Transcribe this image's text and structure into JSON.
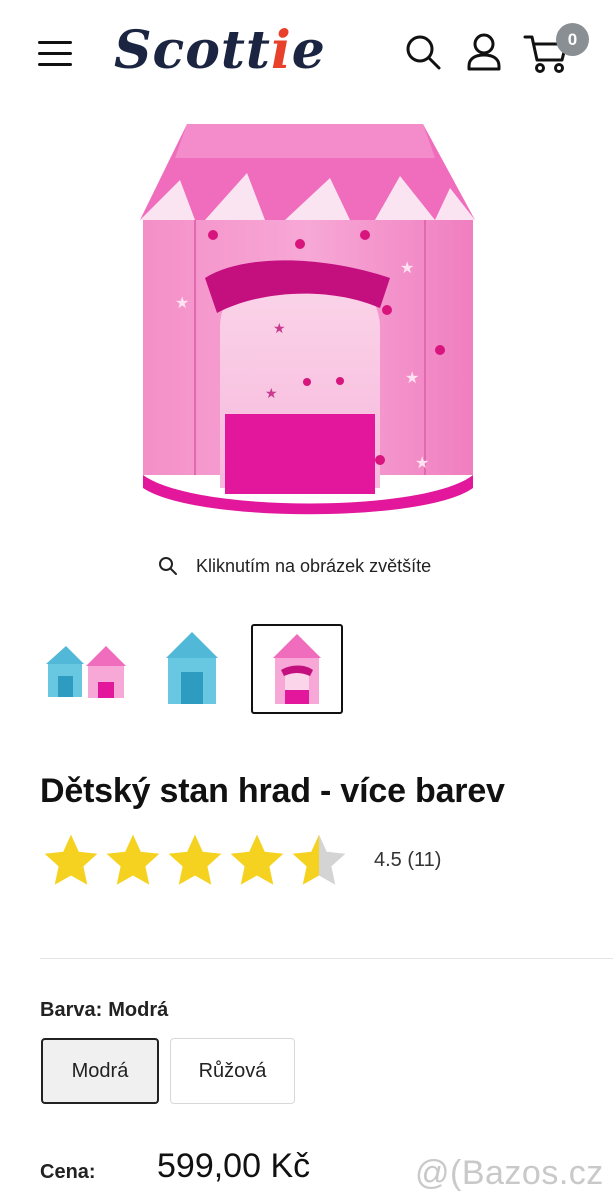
{
  "header": {
    "logo_text": "Scottie",
    "menu_icon": "hamburger-menu-icon",
    "search_icon": "search-icon",
    "account_icon": "user-icon",
    "cart_icon": "cart-icon",
    "cart_count": "0"
  },
  "gallery": {
    "zoom_hint": "Kliknutím na obrázek zvětšíte",
    "zoom_icon": "magnifier-icon",
    "thumbnails": [
      {
        "alt": "blue and pink tents"
      },
      {
        "alt": "blue tent"
      },
      {
        "alt": "pink tent"
      }
    ],
    "selected_thumbnail": 3
  },
  "product": {
    "title": "Dětský stan hrad - více barev",
    "rating": 4.5,
    "rating_text": "4.5 (11)",
    "star_color": "#f5d21f",
    "star_empty_color": "#d4d4d4",
    "variant_label": "Barva:",
    "variant_selected": "Modrá",
    "variants": [
      {
        "label": "Modrá",
        "selected": true
      },
      {
        "label": "Růžová",
        "selected": false
      }
    ],
    "price_label": "Cena:",
    "price": "599,00 Kč"
  },
  "watermark": {
    "text": "Bazos.cz",
    "prefix": "@("
  }
}
